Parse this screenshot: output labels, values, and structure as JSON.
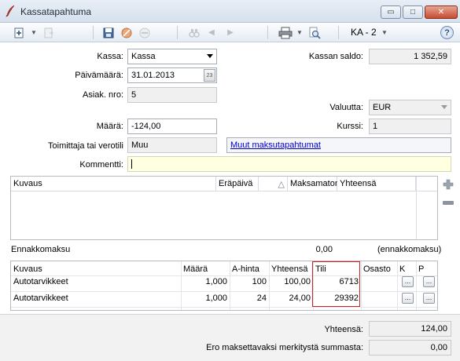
{
  "window": {
    "title": "Kassatapahtuma",
    "minimize": "▭",
    "maximize": "□",
    "close": "✕"
  },
  "toolbar": {
    "new_icon": "new-document-icon",
    "ka_label": "KA - 2",
    "help": "?"
  },
  "form": {
    "kassa_label": "Kassa:",
    "kassa_value": "Kassa",
    "kassan_saldo_label": "Kassan saldo:",
    "kassan_saldo_value": "1 352,59",
    "paivamaara_label": "Päivämäärä:",
    "paivamaara_value": "31.01.2013",
    "calendar_glyph": "23",
    "asiak_nro_label": "Asiak. nro:",
    "asiak_nro_value": "5",
    "valuutta_label": "Valuutta:",
    "valuutta_value": "EUR",
    "maara_label": "Määrä:",
    "maara_value": "-124,00",
    "kurssi_label": "Kurssi:",
    "kurssi_value": "1",
    "toimittaja_label": "Toimittaja tai verotili",
    "toimittaja_value": "Muu",
    "muut_link": "Muut maksutapahtumat",
    "kommentti_label": "Kommentti:",
    "kommentti_value": ""
  },
  "invoice_grid": {
    "columns": [
      "Kuvaus",
      "Eräpäivä",
      "△",
      "Maksamaton",
      "Yhteensä"
    ]
  },
  "ennakko": {
    "label": "Ennakkomaksu",
    "value": "0,00",
    "suffix": "(ennakkomaksu)"
  },
  "rows_grid": {
    "columns": [
      "Kuvaus",
      "Määrä",
      "A-hinta",
      "Yhteensä",
      "Tili",
      "Osasto",
      "K",
      "P"
    ],
    "rows": [
      {
        "kuvaus": "Autotarvikkeet",
        "maara": "1,000",
        "ahinta": "100",
        "yhteensa": "100,00",
        "tili": "6713",
        "osasto": ""
      },
      {
        "kuvaus": "Autotarvikkeet",
        "maara": "1,000",
        "ahinta": "24",
        "yhteensa": "24,00",
        "tili": "29392",
        "osasto": ""
      }
    ],
    "dots": "..."
  },
  "totals": {
    "yhteensa_label": "Yhteensä:",
    "yhteensa_value": "124,00",
    "ero_label": "Ero maksettavaksi merkitystä summasta:",
    "ero_value": "0,00"
  },
  "colors": {
    "highlight": "#d02020",
    "link": "#0000cc",
    "comment_bg": "#ffffe1"
  }
}
